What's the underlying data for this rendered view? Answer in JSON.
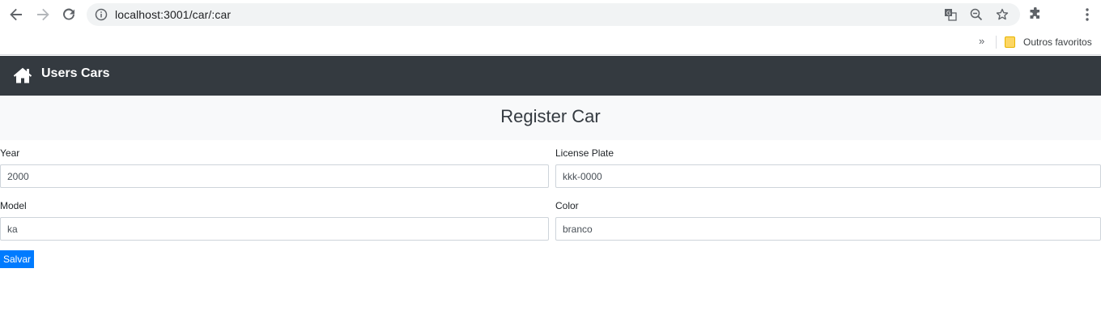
{
  "browser": {
    "url": "localhost:3001/car/:car",
    "icons": {
      "back": "arrow-left-icon",
      "forward": "arrow-right-icon",
      "reload": "reload-icon",
      "site_info": "info-icon",
      "translate": "translate-icon",
      "zoom": "zoom-out-icon",
      "bookmark": "star-icon",
      "extensions": "puzzle-icon",
      "menu": "kebab-menu-icon"
    },
    "bookmarks_bar": {
      "overflow_label": "»",
      "folder_label": "Outros favoritos"
    }
  },
  "navbar": {
    "background": "#343a40",
    "home_icon": "home-icon",
    "links": [
      {
        "label": "Users"
      },
      {
        "label": "Cars"
      }
    ]
  },
  "page": {
    "title": "Register Car",
    "form": {
      "year": {
        "label": "Year",
        "value": "2000"
      },
      "license_plate": {
        "label": "License Plate",
        "value": "kkk-0000"
      },
      "model": {
        "label": "Model",
        "value": "ka"
      },
      "color": {
        "label": "Color",
        "value": "branco"
      },
      "submit_label": "Salvar"
    }
  },
  "colors": {
    "primary": "#007bff",
    "header_bg": "#f8f9fa"
  }
}
